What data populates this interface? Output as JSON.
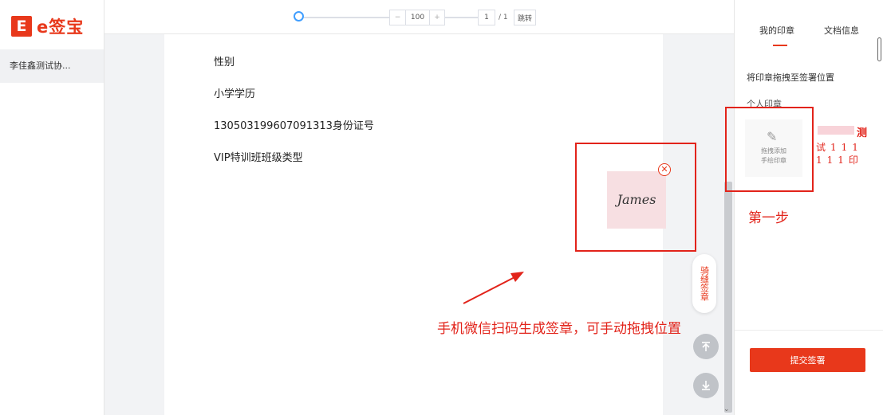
{
  "brand": {
    "mark": "E",
    "name": "e签宝",
    "color": "#e8381b"
  },
  "sidebar": {
    "document_item": "李佳鑫测试协..."
  },
  "toolbar": {
    "zoom": {
      "slider_level": 0,
      "minus": "−",
      "value": "100",
      "plus": "+"
    },
    "page": {
      "current": "1",
      "total": "/ 1",
      "jump": "跳转"
    }
  },
  "document": {
    "fields": [
      "性别",
      "小学学历",
      "130503199607091313身份证号",
      "VIP特训班班级类型"
    ],
    "signature": {
      "text": "James",
      "close_icon": "close-circle-icon"
    },
    "annotation": "手机微信扫码生成签章，可手动拖拽位置",
    "ride_seal": "骑缝签章",
    "scroll_top_icon": "arrow-to-top-icon",
    "scroll_bottom_icon": "arrow-to-bottom-icon",
    "chevron": "⌄"
  },
  "panel": {
    "tabs": [
      {
        "label": "我的印章",
        "active": true
      },
      {
        "label": "文档信息",
        "active": false
      }
    ],
    "hint": "将印章拖拽至签署位置",
    "personal_label": "个人印章",
    "handwritten": {
      "line1": "拖拽添加",
      "line2": "手绘印章",
      "icon": "pen-icon"
    },
    "stamp": {
      "top_char": "测",
      "row1": "试111",
      "row2": "111印"
    },
    "step_label": "第一步",
    "submit": "提交签署"
  },
  "colors": {
    "accent": "#e8381b",
    "annotation_red": "#e2231a"
  }
}
